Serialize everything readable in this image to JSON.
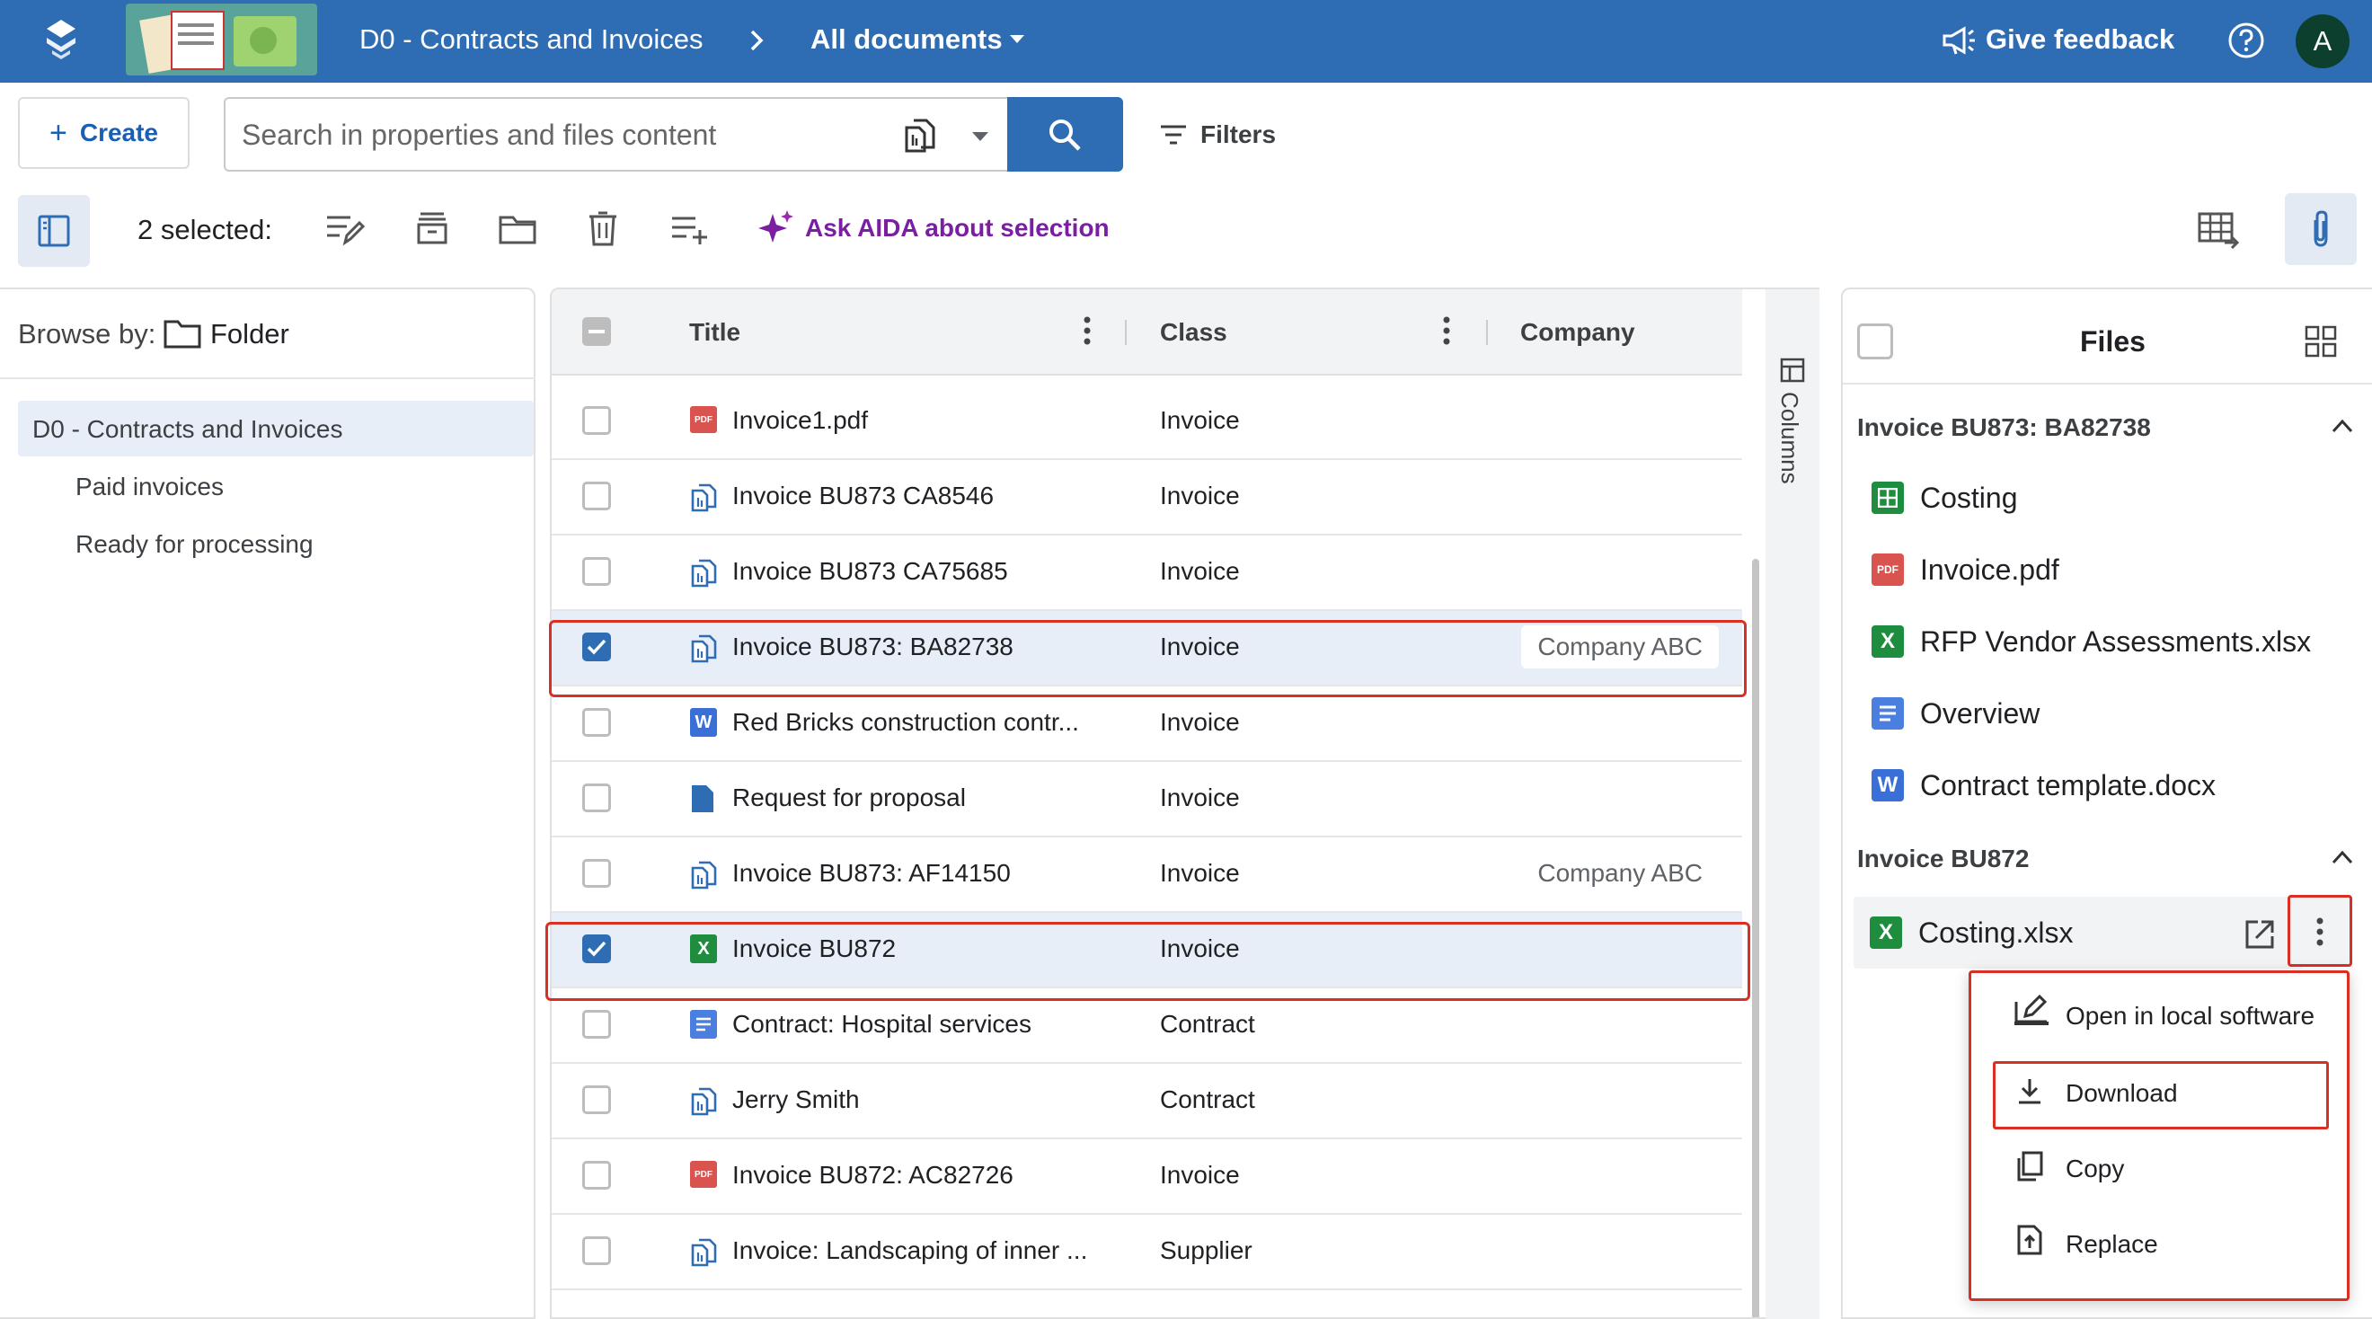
{
  "header": {
    "breadcrumb_root": "D0 - Contracts and Invoices",
    "view_label": "All documents",
    "feedback_label": "Give feedback",
    "avatar_initial": "A"
  },
  "toolbar": {
    "create_label": "Create",
    "search_placeholder": "Search in properties and files content",
    "filters_label": "Filters",
    "selected_text": "2 selected:",
    "ask_aida_label": "Ask AIDA about selection"
  },
  "browse": {
    "label": "Browse by:",
    "mode": "Folder",
    "items": [
      {
        "label": "D0 - Contracts and Invoices"
      },
      {
        "label": "Paid invoices"
      },
      {
        "label": "Ready for processing"
      }
    ]
  },
  "table": {
    "columns": [
      "Title",
      "Class",
      "Company"
    ],
    "columns_toggle_label": "Columns",
    "rows": [
      {
        "title": "Invoice1.pdf",
        "class": "Invoice",
        "company": "",
        "icon": "pdf-icon",
        "checked": false
      },
      {
        "title": "Invoice BU873 CA8546",
        "class": "Invoice",
        "company": "",
        "icon": "multi-file-icon",
        "checked": false
      },
      {
        "title": "Invoice BU873 CA75685",
        "class": "Invoice",
        "company": "",
        "icon": "multi-file-icon",
        "checked": false
      },
      {
        "title": "Invoice BU873: BA82738",
        "class": "Invoice",
        "company": "Company ABC",
        "icon": "multi-file-icon",
        "checked": true
      },
      {
        "title": "Red Bricks construction contr...",
        "class": "Invoice",
        "company": "",
        "icon": "word-icon",
        "checked": false
      },
      {
        "title": "Request for proposal",
        "class": "Invoice",
        "company": "",
        "icon": "document-icon",
        "checked": false
      },
      {
        "title": "Invoice BU873: AF14150",
        "class": "Invoice",
        "company": "Company ABC",
        "icon": "multi-file-icon",
        "checked": false
      },
      {
        "title": "Invoice BU872",
        "class": "Invoice",
        "company": "",
        "icon": "excel-icon",
        "checked": true
      },
      {
        "title": "Contract: Hospital services",
        "class": "Contract",
        "company": "",
        "icon": "doc-lines-icon",
        "checked": false
      },
      {
        "title": "Jerry Smith",
        "class": "Contract",
        "company": "",
        "icon": "multi-file-icon",
        "checked": false
      },
      {
        "title": "Invoice BU872: AC82726",
        "class": "Invoice",
        "company": "",
        "icon": "pdf-icon",
        "checked": false
      },
      {
        "title": "Invoice: Landscaping of inner ...",
        "class": "Supplier",
        "company": "",
        "icon": "multi-file-icon",
        "checked": false
      }
    ]
  },
  "files": {
    "title": "Files",
    "groups": [
      {
        "name": "Invoice BU873: BA82738",
        "items": [
          {
            "label": "Costing",
            "icon": "sheets-icon"
          },
          {
            "label": "Invoice.pdf",
            "icon": "pdf-icon"
          },
          {
            "label": "RFP Vendor Assessments.xlsx",
            "icon": "excel-icon"
          },
          {
            "label": "Overview",
            "icon": "doc-lines-icon"
          },
          {
            "label": "Contract template.docx",
            "icon": "word-icon"
          }
        ]
      },
      {
        "name": "Invoice BU872",
        "items": [
          {
            "label": "Costing.xlsx",
            "icon": "excel-icon"
          }
        ]
      }
    ]
  },
  "context_menu": {
    "items": [
      {
        "label": "Open in local software"
      },
      {
        "label": "Download"
      },
      {
        "label": "Copy"
      },
      {
        "label": "Replace"
      }
    ]
  },
  "colors": {
    "brand": "#2e6db4",
    "highlight": "#d93025",
    "aida": "#7b1fa2",
    "excel": "#1e8e3e",
    "pdf": "#d9534f",
    "word": "#3b6fd8"
  }
}
